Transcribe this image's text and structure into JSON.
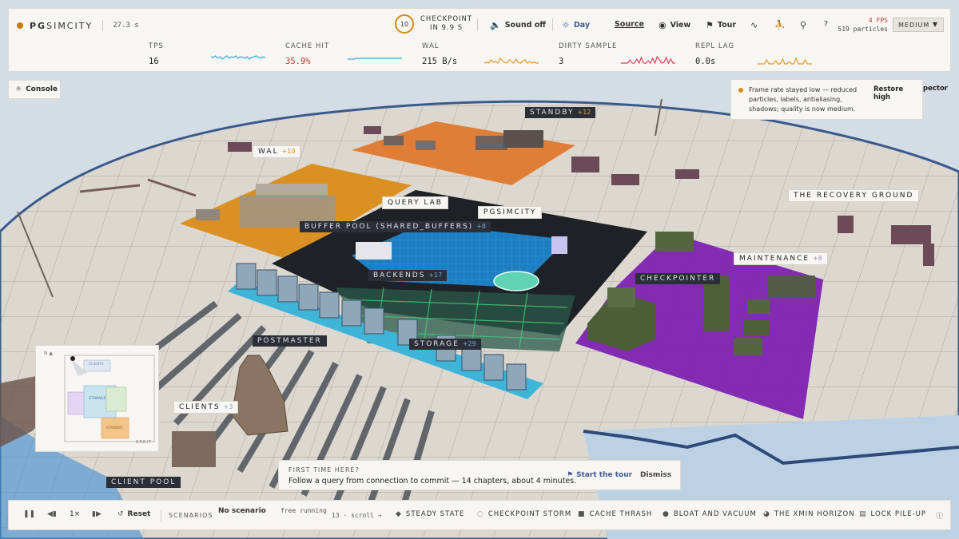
{
  "app": {
    "brand_prefix": "PG",
    "brand_suffix": "SIMCITY",
    "elapsed": "27.3 s"
  },
  "checkpoint": {
    "countdown": "10",
    "label": "CHECKPOINT",
    "sub": "IN 9.9 S"
  },
  "toolbar": {
    "sound": "Sound off",
    "day": "Day",
    "source": "Source",
    "view": "View",
    "tour": "Tour",
    "help": "?"
  },
  "perf": {
    "fps": "4 FPS",
    "particles": "519 particles",
    "quality": "MEDIUM"
  },
  "metrics": [
    {
      "label": "TPS",
      "value": "16",
      "color": "#3aa8d8"
    },
    {
      "label": "CACHE HIT",
      "value": "35.9%",
      "color": "#3aa8d8"
    },
    {
      "label": "WAL",
      "value": "215 B/s",
      "color": "#e39a2c"
    },
    {
      "label": "DIRTY SAMPLE",
      "value": "3",
      "color": "#e0435a"
    },
    {
      "label": "REPL LAG",
      "value": "0.0s",
      "color": "#e39a2c"
    }
  ],
  "console": {
    "label": "Console"
  },
  "notice": {
    "text": "Frame rate stayed low — reduced particles, labels, antialiasing, shadows; quality is now medium.",
    "action": "Restore high",
    "peek": "pector"
  },
  "scene_labels": {
    "standby": {
      "name": "STANDBY",
      "count": "+12"
    },
    "wal": {
      "name": "WAL",
      "count": "+10"
    },
    "query_lab": {
      "name": "QUERY LAB"
    },
    "pgsimcity": {
      "name": "PGSIMCITY"
    },
    "buffer_pool": {
      "name": "BUFFER POOL (SHARED_BUFFERS)",
      "count": "+8"
    },
    "backends": {
      "name": "BACKENDS",
      "count": "+17"
    },
    "recovery": {
      "name": "THE RECOVERY GROUND"
    },
    "maintenance": {
      "name": "MAINTENANCE",
      "count": "+8"
    },
    "checkpointer": {
      "name": "CHECKPOINTER"
    },
    "postmaster": {
      "name": "POSTMASTER"
    },
    "storage": {
      "name": "STORAGE",
      "count": "+29"
    },
    "clients": {
      "name": "CLIENTS",
      "count": "+3"
    },
    "client_pool": {
      "name": "CLIENT POOL"
    }
  },
  "minimap": {
    "north": "N ▲",
    "orbit": "ORBIT",
    "clients": "CLIENTS",
    "storage": "STORAGE",
    "standby": "STANDBY"
  },
  "tour_card": {
    "kicker": "FIRST TIME HERE?",
    "text": "Follow a query from connection to commit — 14 chapters, about 4 minutes.",
    "start": "Start the tour",
    "dismiss": "Dismiss"
  },
  "playback": {
    "speed": "1×",
    "reset": "Reset",
    "scenarios_label": "SCENARIOS",
    "scenario_value": "No scenario",
    "scenario_mode": "free running",
    "scroll_hint": "13 · scroll →",
    "chips": [
      "STEADY STATE",
      "CHECKPOINT STORM",
      "CACHE THRASH",
      "BLOAT AND VACUUM",
      "THE XMIN HORIZON",
      "LOCK PILE-UP"
    ]
  },
  "colors": {
    "accent": "#d08a1c",
    "danger": "#c0392b",
    "link": "#3f5a96",
    "standby_zone": "#e0762a",
    "wal_zone": "#d98a12",
    "maintenance_zone": "#7d22b0",
    "buffer_pool": "#1d7fc2",
    "storage_strip": "#3fb4d9"
  }
}
